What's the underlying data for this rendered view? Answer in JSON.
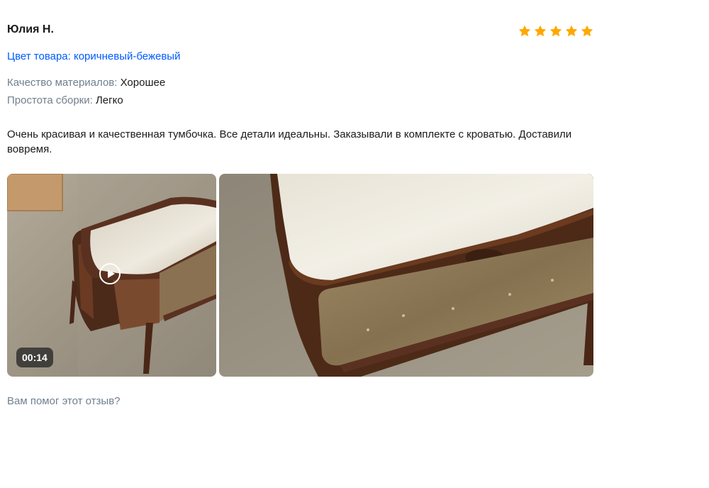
{
  "review": {
    "author": "Юлия Н.",
    "rating": 5,
    "star_color": "#ffa800",
    "color_line": "Цвет товара: коричневый-бежевый",
    "properties": [
      {
        "key": "Качество материалов:",
        "value": "Хорошее"
      },
      {
        "key": "Простота сборки:",
        "value": "Легко"
      }
    ],
    "text": "Очень красивая и качественная тумбочка. Все детали идеальны. Заказывали в комплекте с кроватью. Доставили вовремя.",
    "media": [
      {
        "type": "video",
        "icon": "play-icon",
        "duration": "00:14"
      },
      {
        "type": "photo"
      }
    ],
    "helpful_question": "Вам помог этот отзыв?"
  },
  "colors": {
    "link": "#005bff",
    "muted": "#707f8d",
    "text": "#1a1a1a"
  }
}
